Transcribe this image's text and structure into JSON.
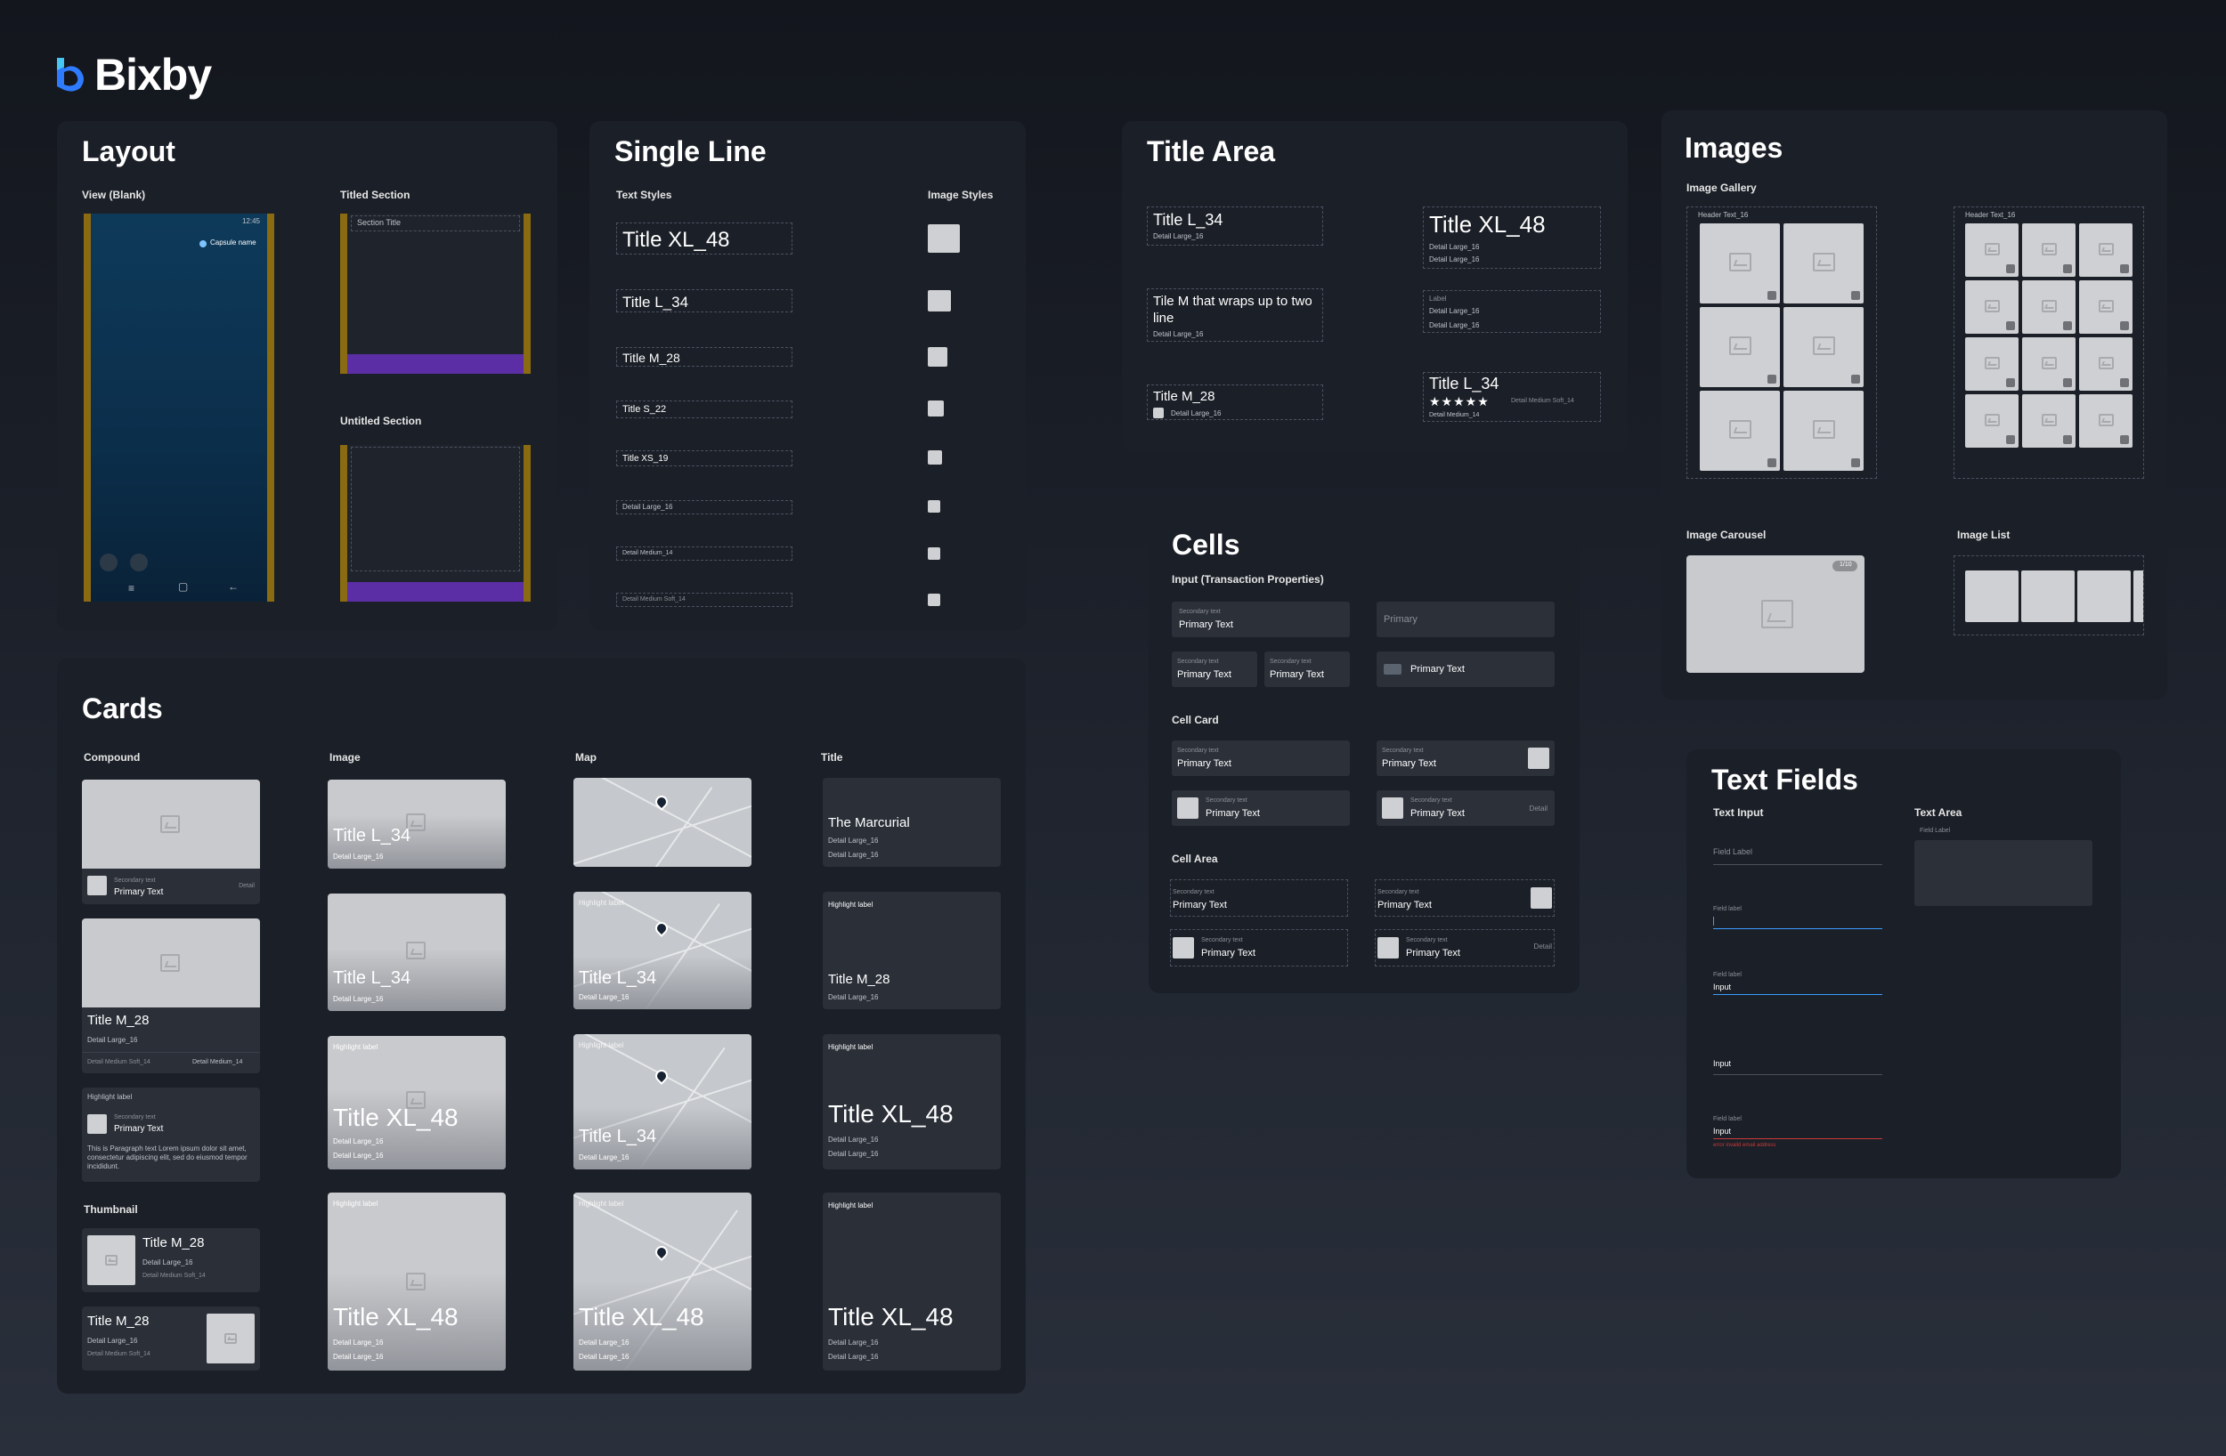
{
  "brand": {
    "name": "Bixby",
    "logo_color": "#3a8dff"
  },
  "colors": {
    "accent_purple": "#5b2ea6",
    "accent_gold": "#8b6b12",
    "error_red": "#c83a3a",
    "focus_blue": "#3b9cff"
  },
  "layout": {
    "title": "Layout",
    "view_blank": "View (Blank)",
    "titled_section": "Titled Section",
    "untitled_section": "Untitled Section",
    "status_time": "12:45",
    "capsule": "Capsule name",
    "section_title": "Section Title"
  },
  "single_line": {
    "title": "Single Line",
    "text_styles": "Text Styles",
    "image_styles": "Image Styles",
    "items": [
      "Title XL_48",
      "Title L_34",
      "Title M_28",
      "Title S_22",
      "Title XS_19",
      "Detail Large_16",
      "Detail Medium_14",
      "Detail Medium Soft_14"
    ]
  },
  "title_area": {
    "title": "Title Area",
    "a1_title": "Title L_34",
    "a1_detail": "Detail Large_16",
    "a2_title": "Tile M that wraps up to two line",
    "a2_detail": "Detail Large_16",
    "a3_title": "Title M_28",
    "a3_detail": "Detail Large_16",
    "b1_title": "Title XL_48",
    "b1_d1": "Detail Large_16",
    "b1_d2": "Detail Large_16",
    "b2_label": "Label",
    "b2_d1": "Detail Large_16",
    "b2_d2": "Detail Large_16",
    "b3_title": "Title L_34",
    "b3_soft": "Detail Medium Soft_14",
    "b3_detail": "Detail Medium_14"
  },
  "images": {
    "title": "Images",
    "gallery": "Image Gallery",
    "header1": "Header Text_16",
    "header2": "Header Text_16",
    "carousel": "Image Carousel",
    "carousel_badge": "1/10",
    "list": "Image List"
  },
  "cells": {
    "title": "Cells",
    "input_label": "Input (Transaction Properties)",
    "cell_card": "Cell Card",
    "cell_area": "Cell Area",
    "secondary": "Secondary text",
    "primary": "Primary Text",
    "primary_placeholder": "Primary",
    "detail": "Detail"
  },
  "cards": {
    "title": "Cards",
    "col_compound": "Compound",
    "col_image": "Image",
    "col_map": "Map",
    "col_title": "Title",
    "thumbnail": "Thumbnail",
    "secondary": "Secondary text",
    "primary": "Primary Text",
    "detail": "Detail",
    "title_m": "Title M_28",
    "title_l": "Title L_34",
    "title_xl": "Title XL_48",
    "detail_large": "Detail Large_16",
    "detail_medium": "Detail Medium_14",
    "detail_medium_soft": "Detail Medium Soft_14",
    "highlight": "Highlight label",
    "paragraph": "This is Paragraph text Lorem ipsum dolor sit amet, consectetur adipiscing elit, sed do eiusmod tempor incididunt.",
    "marcurial": "The Marcurial"
  },
  "text_fields": {
    "title": "Text Fields",
    "text_input": "Text Input",
    "text_area": "Text Area",
    "field_label_cap": "Field Label",
    "field_label": "Field label",
    "input": "Input",
    "error": "error invalid email address"
  }
}
